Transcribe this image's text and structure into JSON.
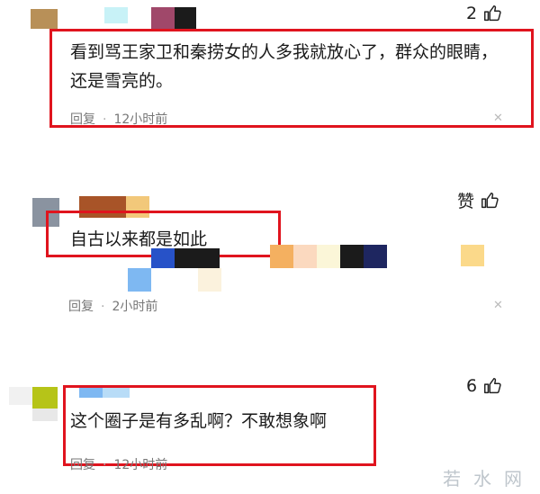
{
  "comments": [
    {
      "text": "看到骂王家卫和秦捞女的人多我就放心了，群众的眼睛，还是雪亮的。",
      "reply_label": "回复",
      "time": "12小时前",
      "like_count": "2"
    },
    {
      "text": "自古以来都是如此",
      "reply_label": "回复",
      "time": "2小时前",
      "like_count": "赞"
    },
    {
      "text": "这个圈子是有多乱啊？不敢想象啊",
      "reply_label": "回复",
      "time": "12小时前",
      "like_count": "6"
    }
  ],
  "watermark": "若水网",
  "colors": {
    "highlight_border": "#e0141e",
    "meta_text": "#777777"
  },
  "icons": [
    "thumbs-up-icon",
    "close-icon"
  ]
}
